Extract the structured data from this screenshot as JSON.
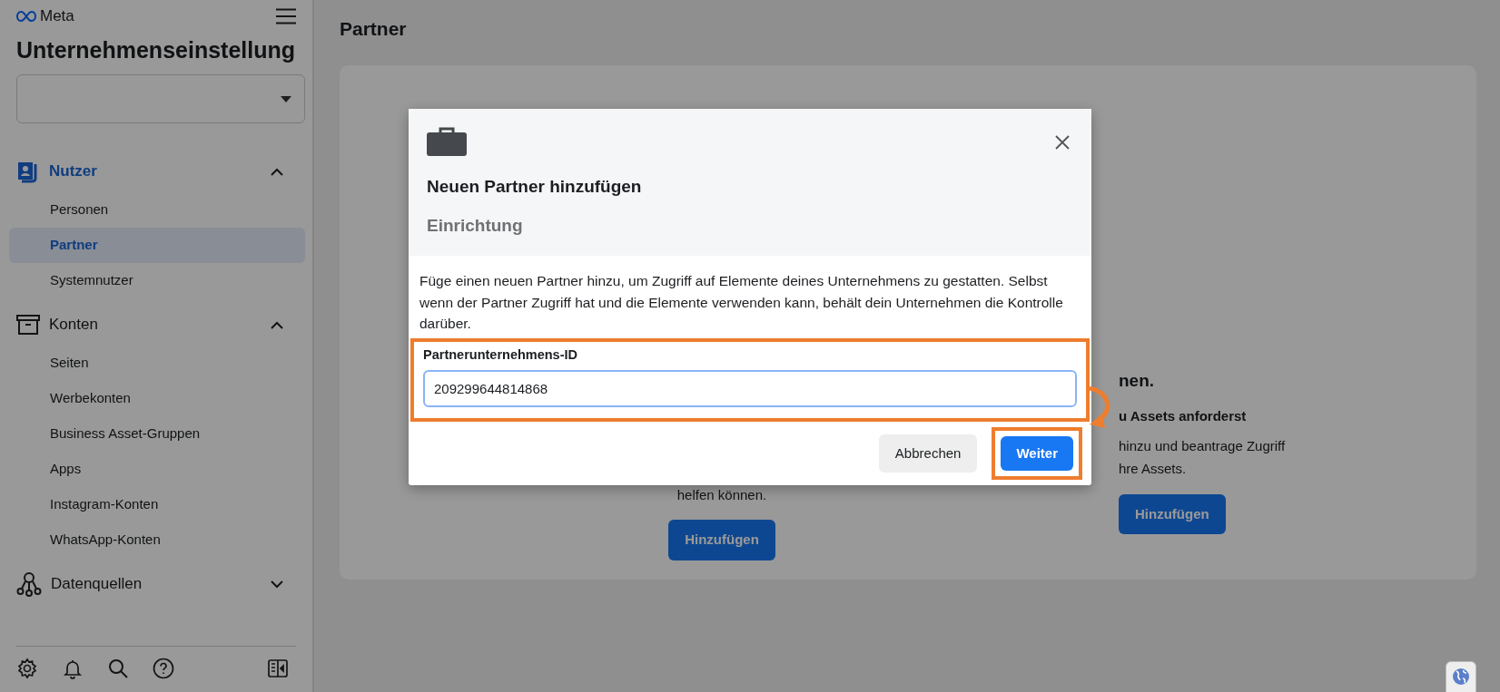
{
  "sidebar": {
    "logo": "Meta",
    "title": "Unternehmenseinstellung",
    "sections": [
      {
        "label": "Nutzer",
        "active": true,
        "expanded": true,
        "items": [
          {
            "label": "Personen",
            "selected": false
          },
          {
            "label": "Partner",
            "selected": true
          },
          {
            "label": "Systemnutzer",
            "selected": false
          }
        ]
      },
      {
        "label": "Konten",
        "active": false,
        "expanded": true,
        "items": [
          {
            "label": "Seiten",
            "selected": false
          },
          {
            "label": "Werbekonten",
            "selected": false
          },
          {
            "label": "Business Asset-Gruppen",
            "selected": false
          },
          {
            "label": "Apps",
            "selected": false
          },
          {
            "label": "Instagram-Konten",
            "selected": false
          },
          {
            "label": "WhatsApp-Konten",
            "selected": false
          }
        ]
      },
      {
        "label": "Datenquellen",
        "active": false,
        "expanded": false
      }
    ]
  },
  "page": {
    "title": "Partner",
    "left_option": {
      "text": "helfen können.",
      "button": "Hinzufügen"
    },
    "right_option": {
      "heading": "nen.",
      "subheading": "u Assets anforderst",
      "lines": [
        "hinzu und beantrage Zugriff",
        "hre Assets."
      ],
      "button": "Hinzufügen"
    }
  },
  "dialog": {
    "title": "Neuen Partner hinzufügen",
    "subtitle": "Einrichtung",
    "description": "Füge einen neuen Partner hinzu, um Zugriff auf Elemente deines Unternehmens zu gestatten. Selbst wenn der Partner Zugriff hat und die Elemente verwenden kann, behält dein Unternehmen die Kontrolle darüber.",
    "field": {
      "label": "Partnerunternehmens-ID",
      "value": "209299644814868",
      "highlighted": true
    },
    "buttons": [
      {
        "label": "Abbrechen",
        "kind": "secondary"
      },
      {
        "label": "Weiter",
        "kind": "primary",
        "highlighted": true
      }
    ]
  }
}
